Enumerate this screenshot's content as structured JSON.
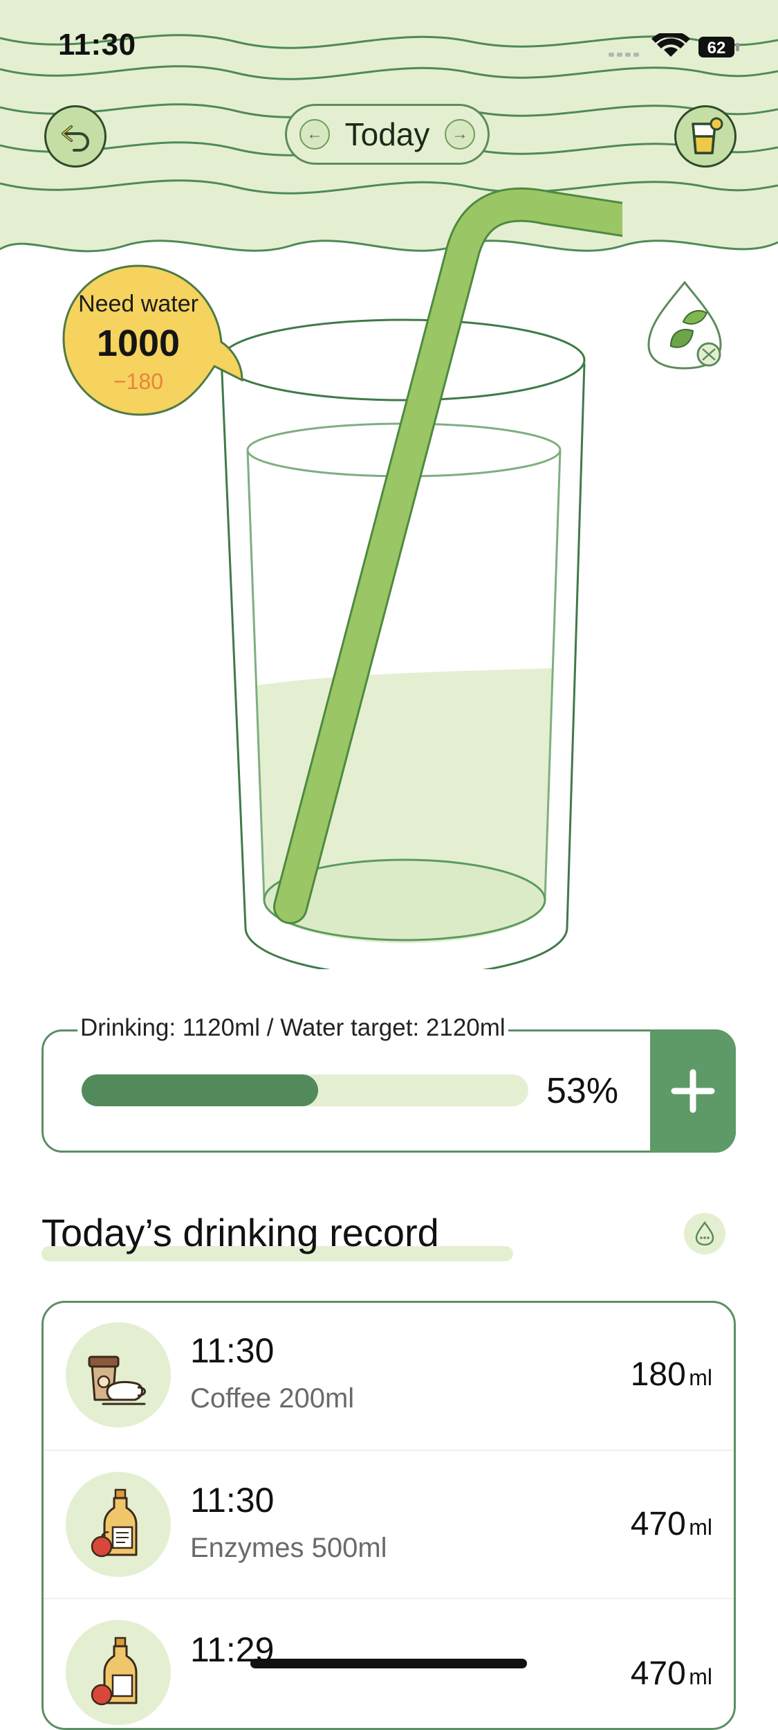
{
  "status_bar": {
    "time": "11:30",
    "battery": "62"
  },
  "header": {
    "date_label": "Today"
  },
  "need_water": {
    "title": "Need water",
    "value": "1000",
    "delta": "−180"
  },
  "progress": {
    "caption": "Drinking: 1120ml / Water target: 2120ml",
    "percent_label": "53%",
    "percent_value": 53,
    "add_symbol": "+"
  },
  "records": {
    "title": "Today’s drinking record",
    "items": [
      {
        "time": "11:30",
        "drink": "Coffee 200ml",
        "amount": "180",
        "unit": "ml",
        "icon": "coffee-icon"
      },
      {
        "time": "11:30",
        "drink": "Enzymes 500ml",
        "amount": "470",
        "unit": "ml",
        "icon": "enzymes-bottle-icon"
      },
      {
        "time": "11:29",
        "drink": "",
        "amount": "470",
        "unit": "ml",
        "icon": "enzymes-bottle-icon"
      }
    ]
  },
  "colors": {
    "header_bg": "#e4efd1",
    "accent_green": "#5e9a67",
    "progress_fill": "#538a5b",
    "need_bubble": "#f5d35e",
    "delta_orange": "#e8833d"
  }
}
